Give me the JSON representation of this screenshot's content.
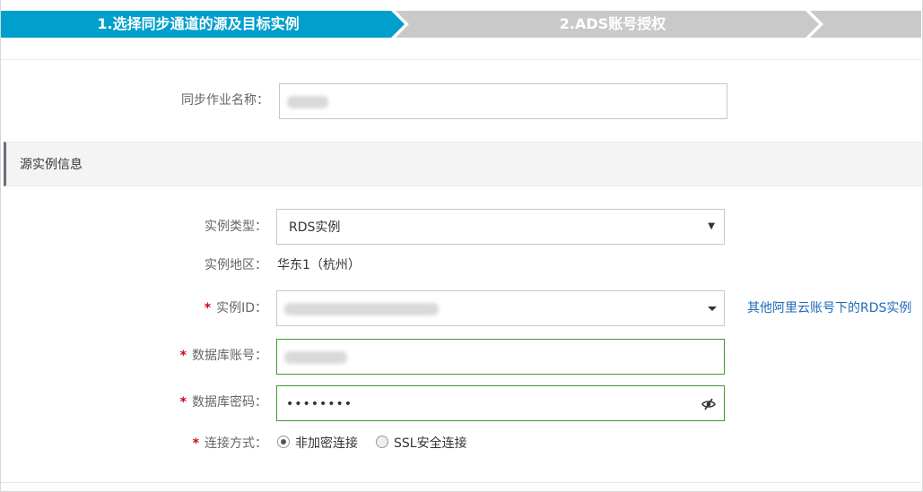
{
  "steps": [
    {
      "label": "1.选择同步通道的源及目标实例",
      "state": "active"
    },
    {
      "label": "2.ADS账号授权",
      "state": "inactive"
    }
  ],
  "colors": {
    "step_active": "#009fcc",
    "step_inactive": "#c9c9c9",
    "required": "#d0021b",
    "link": "#1e6bb8",
    "valid_border": "#3c9a2c"
  },
  "job_name": {
    "label": "同步作业名称：",
    "value_redacted": true
  },
  "section": {
    "title": "源实例信息"
  },
  "instance_type": {
    "label": "实例类型：",
    "value": "RDS实例",
    "arrow": "▼"
  },
  "instance_region": {
    "label": "实例地区：",
    "value": "华东1（杭州）"
  },
  "instance_id": {
    "required_mark": "*",
    "label": "实例ID：",
    "value_redacted": true,
    "other_account_link": "其他阿里云账号下的RDS实例"
  },
  "db_account": {
    "required_mark": "*",
    "label": "数据库账号：",
    "value_redacted": true
  },
  "db_password": {
    "required_mark": "*",
    "label": "数据库密码：",
    "value": "••••••••",
    "toggle_icon": "eye-slash-icon"
  },
  "connection": {
    "required_mark": "*",
    "label": "连接方式：",
    "options": [
      {
        "label": "非加密连接",
        "checked": true
      },
      {
        "label": "SSL安全连接",
        "checked": false
      }
    ]
  }
}
